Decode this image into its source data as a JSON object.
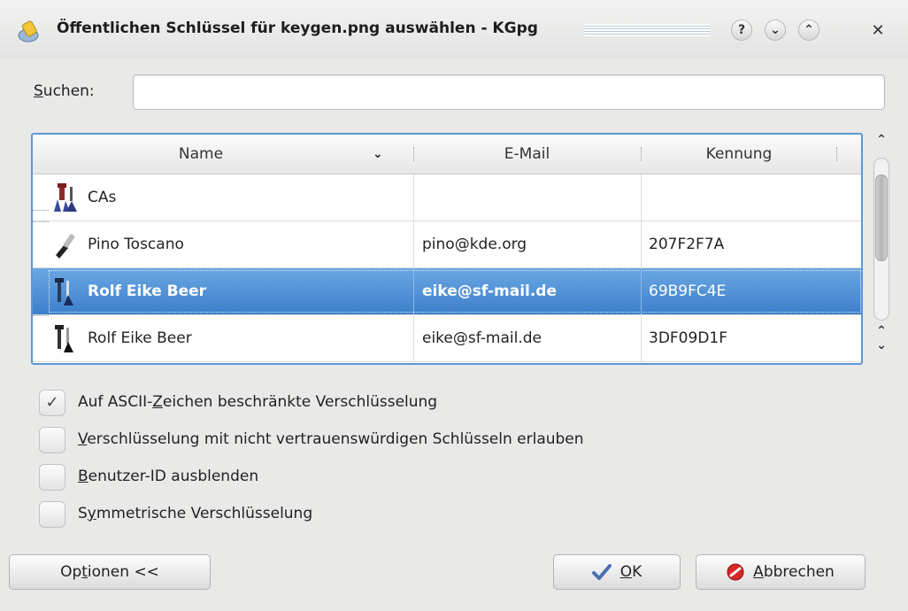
{
  "window": {
    "title": "Öffentlichen Schlüssel für keygen.png auswählen - KGpg",
    "help_label": "?",
    "minimize_label": "⌄",
    "maximize_label": "⌃",
    "close_label": "✕"
  },
  "search": {
    "label_u": "S",
    "label_rest": "uchen:",
    "value": "",
    "placeholder": ""
  },
  "table": {
    "columns": {
      "name": "Name",
      "email": "E-Mail",
      "id": "Kennung"
    },
    "rows": [
      {
        "name": "CAs",
        "email": "",
        "id": "",
        "icon": "key-pair-group-icon"
      },
      {
        "name": "Pino Toscano",
        "email": "pino@kde.org",
        "id": "207F2F7A",
        "icon": "key-icon"
      },
      {
        "name": "Rolf Eike Beer",
        "email": "eike@sf-mail.de",
        "id": "69B9FC4E",
        "icon": "key-pair-icon",
        "selected": true
      },
      {
        "name": "Rolf Eike Beer",
        "email": "eike@sf-mail.de",
        "id": "3DF09D1F",
        "icon": "key-pair-icon"
      }
    ]
  },
  "options": [
    {
      "pre": "Auf ASCII-",
      "u": "Z",
      "post": "eichen beschränkte Verschlüsselung",
      "checked": true
    },
    {
      "pre": "",
      "u": "V",
      "post": "erschlüsselung mit nicht vertrauenswürdigen Schlüsseln erlauben",
      "checked": false
    },
    {
      "pre": "",
      "u": "B",
      "post": "enutzer-ID ausblenden",
      "checked": false
    },
    {
      "pre": "S",
      "u": "y",
      "post": "mmetrische Verschlüsselung",
      "checked": false
    }
  ],
  "buttons": {
    "options": {
      "pre": "Op",
      "u": "t",
      "post": "ionen <<"
    },
    "ok": {
      "pre": "",
      "u": "O",
      "post": "K"
    },
    "cancel": {
      "pre": "",
      "u": "A",
      "post": "bbrechen"
    }
  }
}
